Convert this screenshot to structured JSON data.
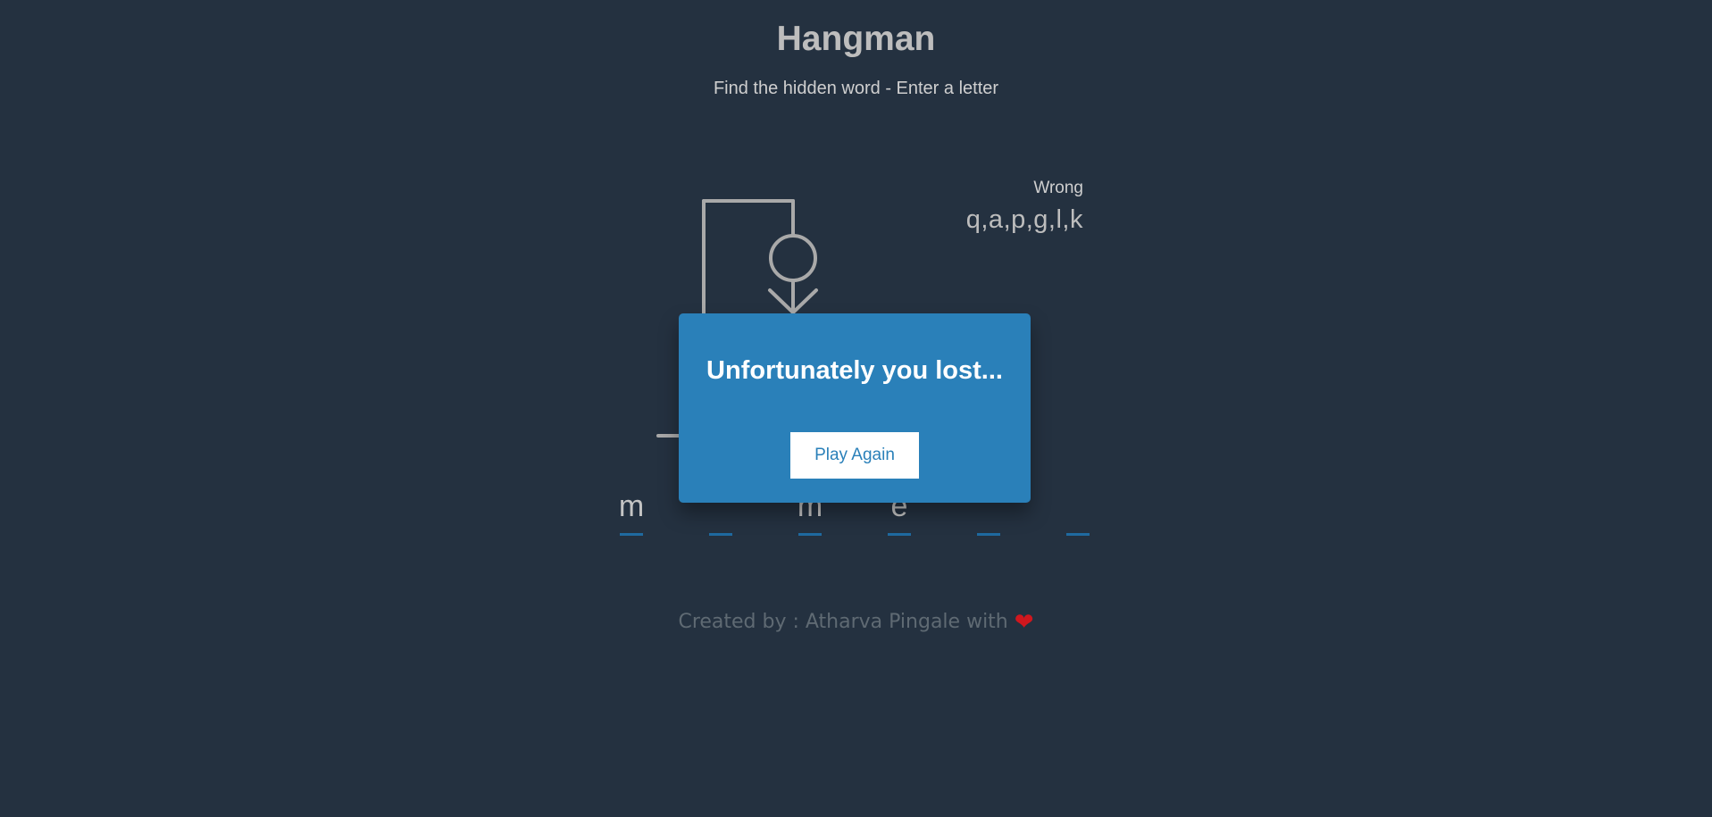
{
  "header": {
    "title": "Hangman",
    "subtitle": "Find the hidden word - Enter a letter"
  },
  "wrong": {
    "label": "Wrong",
    "letters": "q,a,p,g,l,k"
  },
  "word": {
    "slots": [
      "m",
      "",
      "m",
      "e",
      "",
      ""
    ]
  },
  "modal": {
    "message": "Unfortunately you lost...",
    "button_label": "Play Again"
  },
  "footer": {
    "text": "Created by : Atharva Pingale  with",
    "heart_icon": "heart-icon"
  },
  "colors": {
    "background": "#243140",
    "modal": "#2a80b9",
    "underline": "#1f6aa0",
    "heart": "#d0171e"
  }
}
